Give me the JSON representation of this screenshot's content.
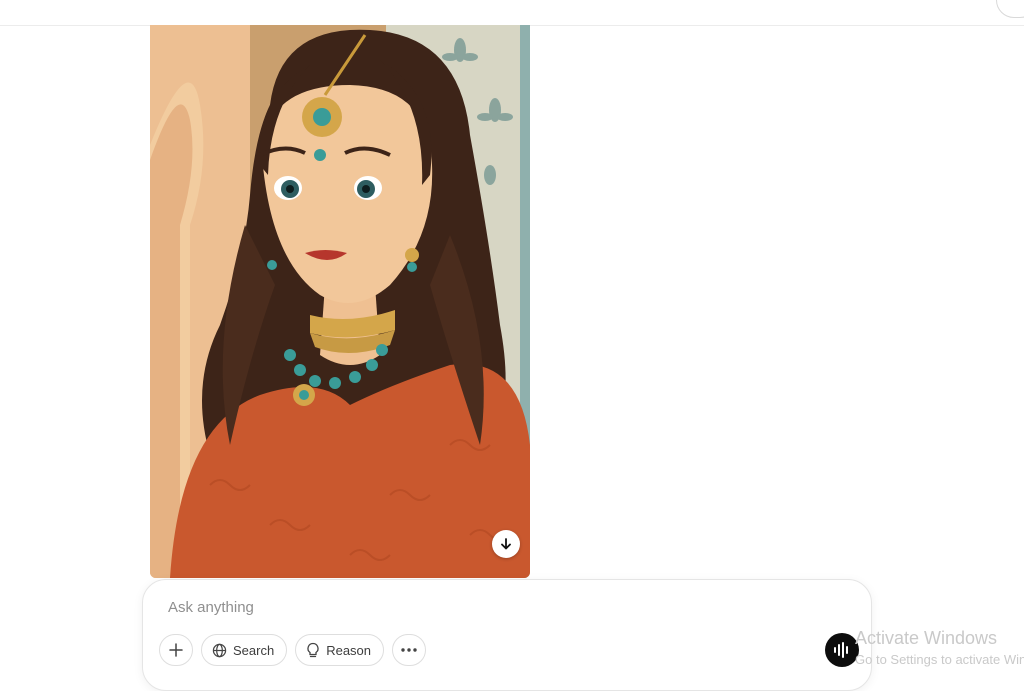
{
  "composer": {
    "placeholder": "Ask anything",
    "tools": [
      {
        "label": "Search",
        "icon": "globe-icon"
      },
      {
        "label": "Reason",
        "icon": "lightbulb-icon"
      }
    ],
    "add_icon": "plus-icon",
    "more_icon": "ellipsis-icon",
    "voice_icon": "voice-mode-icon"
  },
  "image": {
    "description": "generated portrait illustration",
    "download_icon": "download-arrow-icon"
  },
  "watermark": {
    "title": "Activate Windows",
    "subtitle": "Go to Settings to activate Windows."
  },
  "colors": {
    "voice_button": "#0d0d0d",
    "dress": "#c9582e",
    "jewel": "#3a9c98"
  }
}
